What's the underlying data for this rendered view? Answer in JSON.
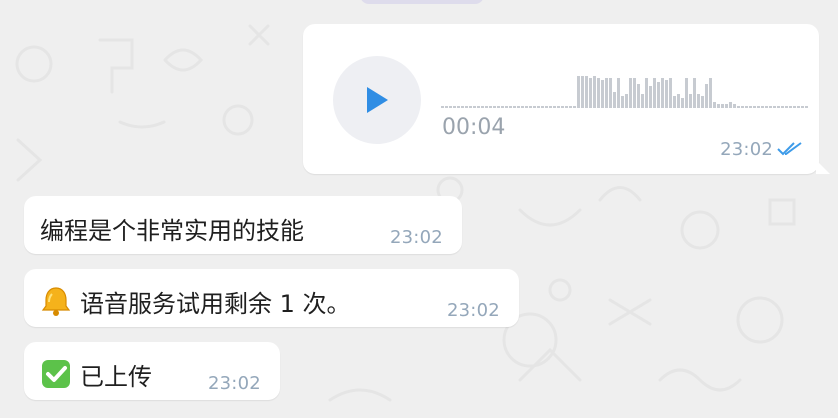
{
  "colors": {
    "background": "#efefef",
    "bubble": "#ffffff",
    "play_icon": "#2f8de4",
    "waveform": "#c7cbd1",
    "timestamp": "#94a7ba",
    "read_ticks": "#3d9be9"
  },
  "voice_message": {
    "duration": "00:04",
    "time": "23:02",
    "status_icon": "double-check-read",
    "play_icon": "play-icon"
  },
  "messages": [
    {
      "text": "编程是个非常实用的技能",
      "time": "23:02",
      "emoji": ""
    },
    {
      "text": "语音服务试用剩余 1 次。",
      "time": "23:02",
      "emoji": "bell-icon"
    },
    {
      "text": "已上传",
      "time": "23:02",
      "emoji": "check-mark-icon"
    }
  ]
}
